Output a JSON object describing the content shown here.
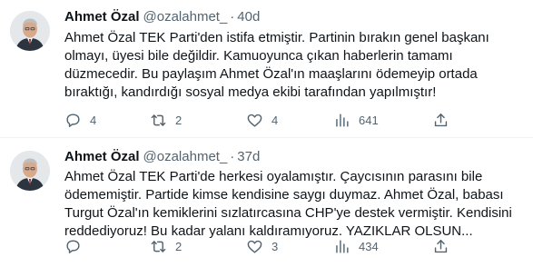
{
  "tweets": [
    {
      "author": "Ahmet Özal",
      "handle": "@ozalahmet_",
      "separator": "·",
      "time": "40d",
      "lines": [
        "Ahmet Özal TEK Parti'den istifa etmiştir. Partinin bırakın genel başkanı",
        "olmayı, üyesi bile değildir. Kamuoyunca çıkan haberlerin tamamı",
        "düzmecedir. Bu paylaşım Ahmet Özal'ın maaşlarını ödemeyip ortada",
        "bıraktığı, kandırdığı sosyal medya ekibi tarafından yapılmıştır!"
      ],
      "replies": "4",
      "retweets": "2",
      "likes": "4",
      "views": "641"
    },
    {
      "author": "Ahmet Özal",
      "handle": "@ozalahmet_",
      "separator": "·",
      "time": "37d",
      "lines": [
        "Ahmet Özal TEK Parti'de herkesi oyalamıştır. Çaycısının parasını bile",
        "ödememiştir. Partide kimse kendisine saygı duymaz. Ahmet Özal, babası",
        "Turgut Özal'ın kemiklerini sızlatırcasına CHP'ye destek vermiştir. Kendisini",
        "reddediyoruz! Bu kadar yalanı kaldıramıyoruz. YAZIKLAR OLSUN..."
      ],
      "replies": "",
      "retweets": "2",
      "likes": "3",
      "views": "434"
    }
  ],
  "icons": {
    "reply": "reply-icon",
    "retweet": "retweet-icon",
    "like": "heart-icon",
    "views": "views-icon",
    "share": "share-icon"
  },
  "colors": {
    "text": "#0f1419",
    "muted": "#536471",
    "divider": "#eff3f4"
  }
}
